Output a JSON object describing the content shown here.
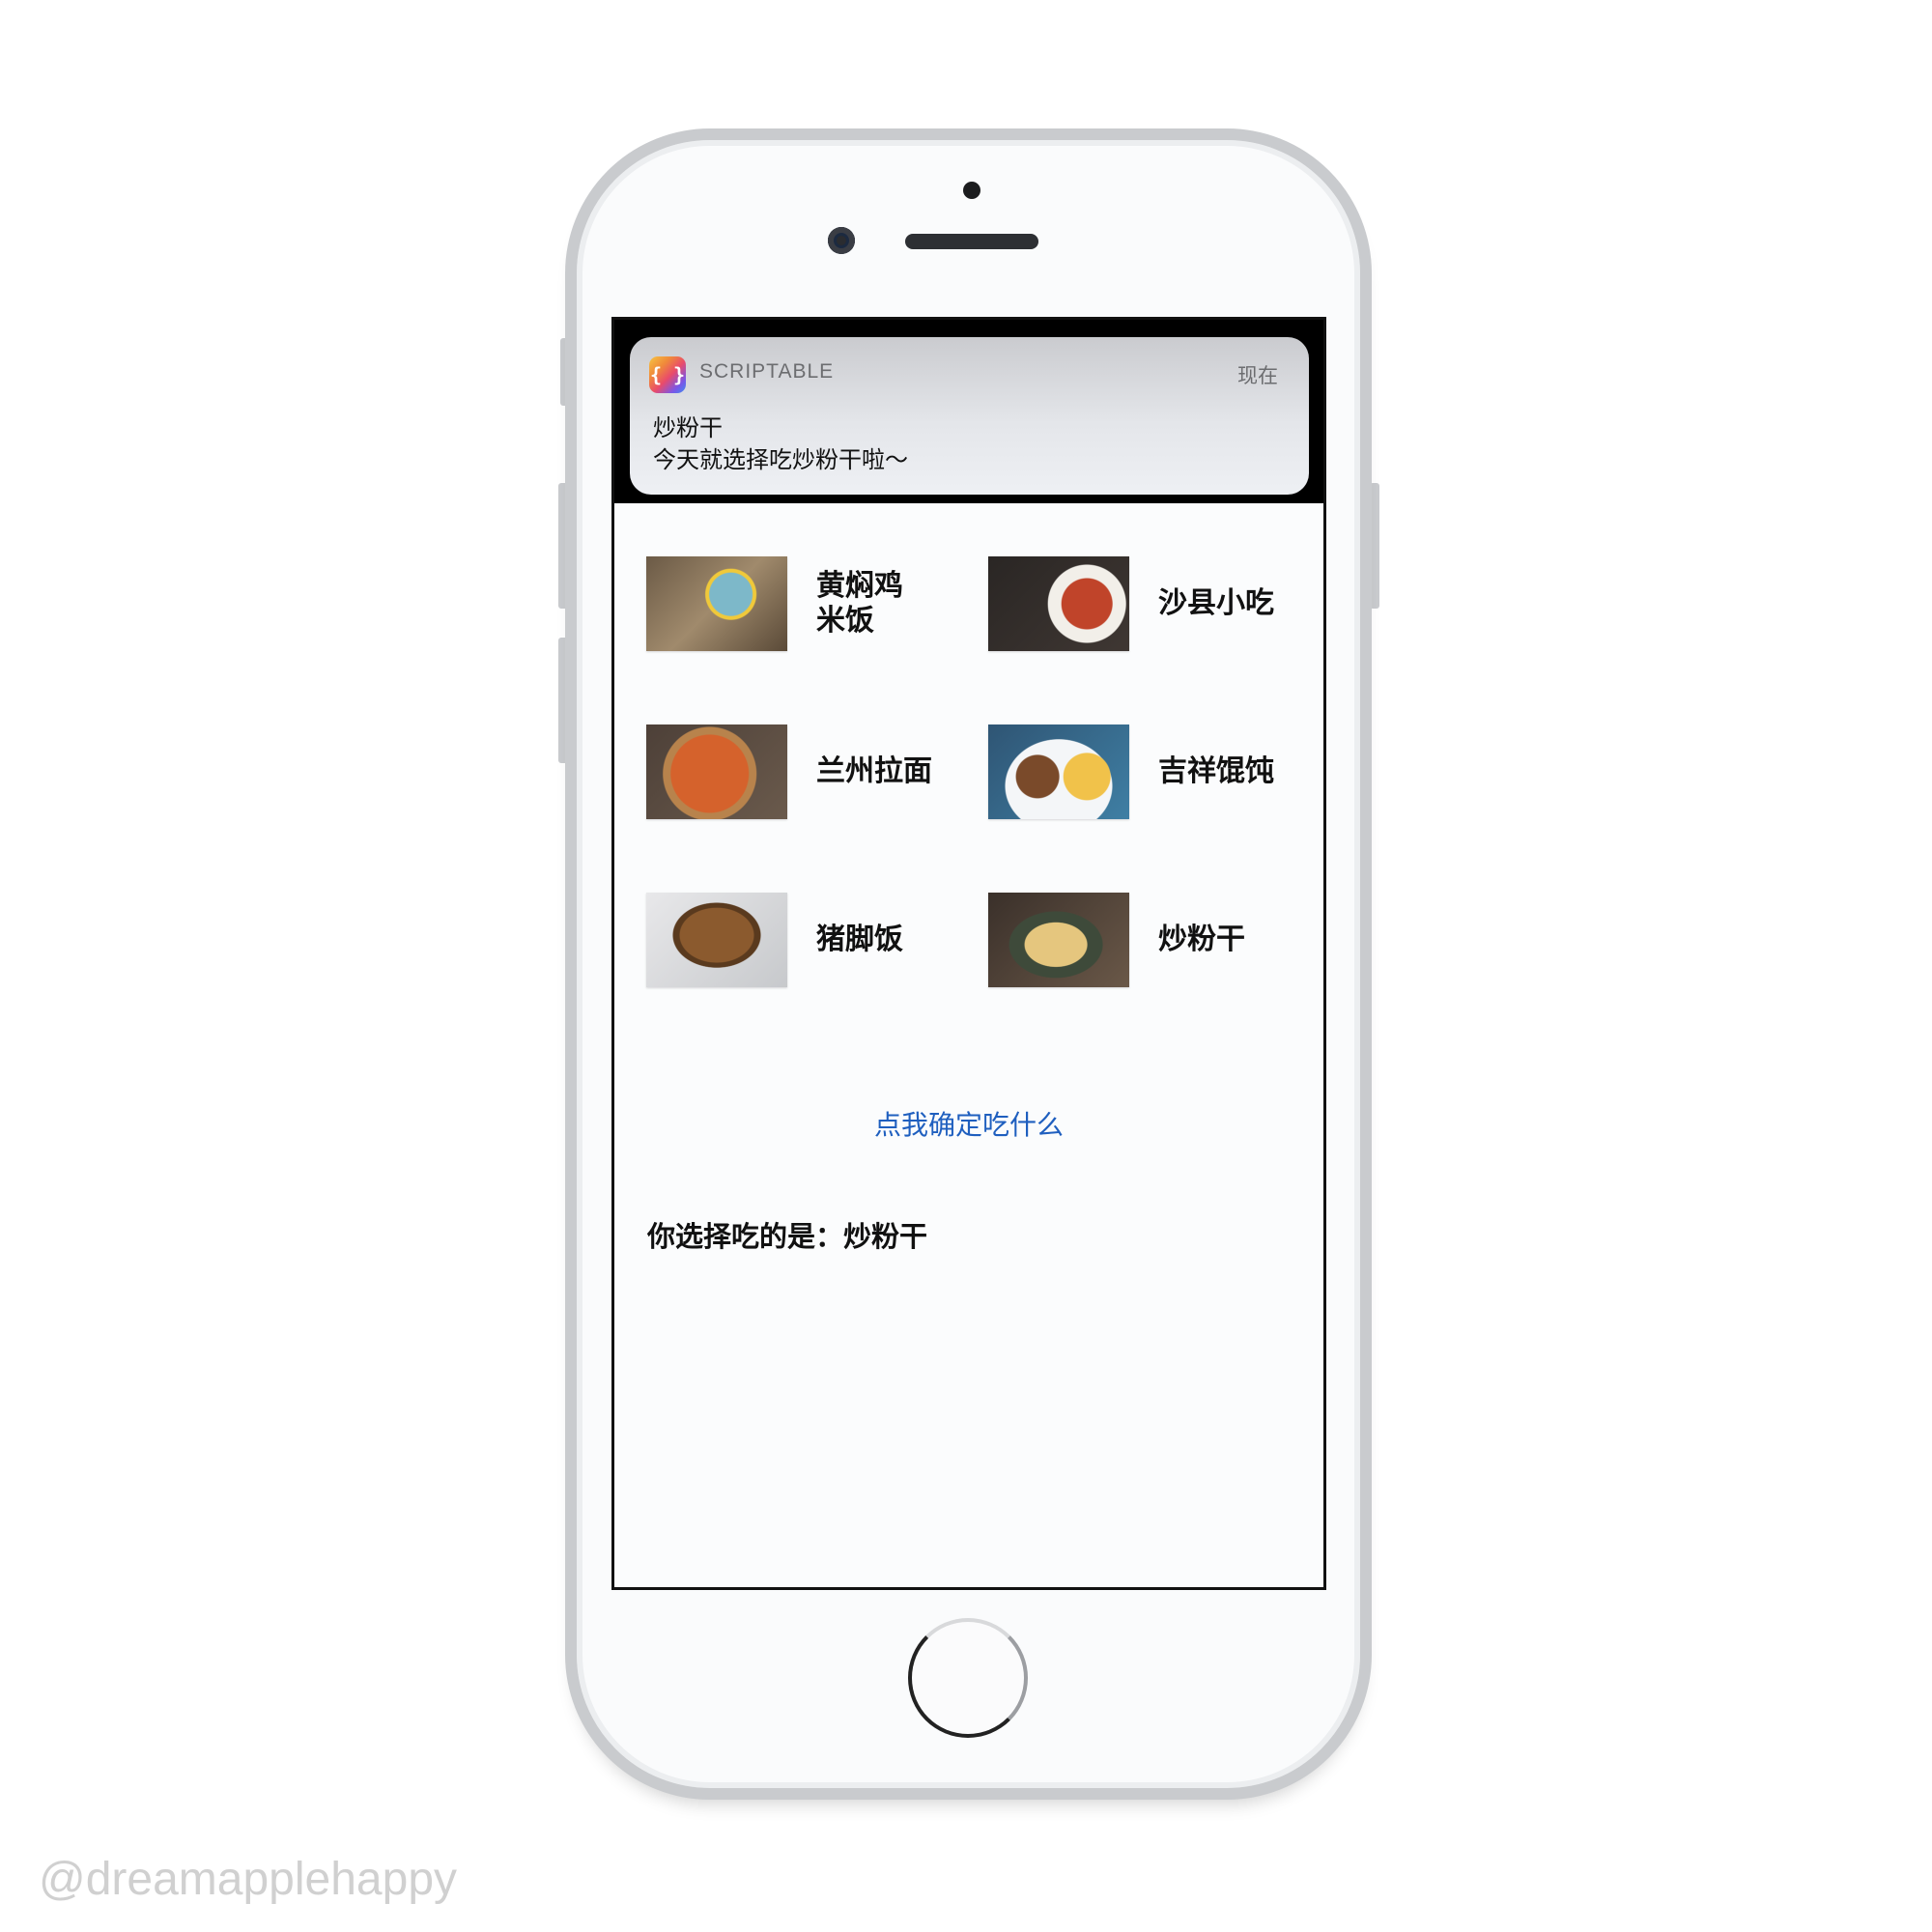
{
  "notification": {
    "app_name": "SCRIPTABLE",
    "time": "现在",
    "title": "炒粉干",
    "body": "今天就选择吃炒粉干啦～",
    "icon": "scriptable-app-icon",
    "icon_glyph": "{ }"
  },
  "food_items": [
    {
      "label": "黄焖鸡\n米饭"
    },
    {
      "label": "沙县小吃"
    },
    {
      "label": "兰州拉面"
    },
    {
      "label": "吉祥馄饨"
    },
    {
      "label": "猪脚饭"
    },
    {
      "label": "炒粉干"
    }
  ],
  "pick_link_label": "点我确定吃什么",
  "result_text": "你选择吃的是：炒粉干",
  "watermark": "@dreamapplehappy",
  "colors": {
    "link": "#1f5fbf",
    "phone_frame": "#c9cbce"
  }
}
